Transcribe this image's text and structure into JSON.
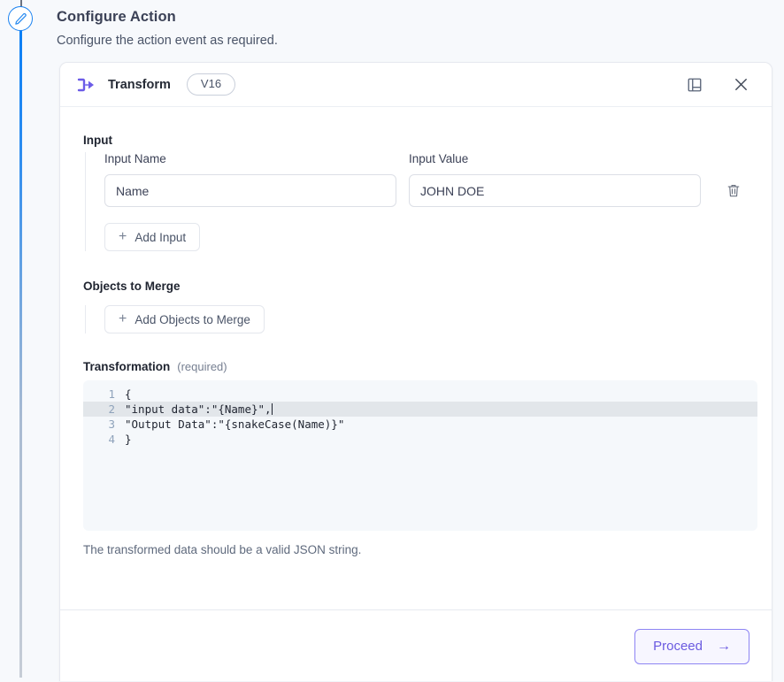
{
  "page": {
    "title": "Configure Action",
    "subtitle": "Configure the action event as required."
  },
  "rail": {
    "node_icon": "pencil-icon"
  },
  "card": {
    "icon": "transform-icon",
    "title": "Transform",
    "version_badge": "V16",
    "notes_icon": "notebook-icon",
    "close_icon": "close-icon"
  },
  "input_section": {
    "heading": "Input",
    "name_label": "Input Name",
    "name_value": "Name",
    "name_placeholder": "Name",
    "value_label": "Input Value",
    "value_value": "JOHN DOE",
    "value_placeholder": "Input Value",
    "delete_icon": "trash-icon",
    "add_button": "Add Input",
    "add_icon": "plus-icon"
  },
  "merge_section": {
    "heading": "Objects to Merge",
    "add_button": "Add Objects to Merge",
    "add_icon": "plus-icon"
  },
  "transformation_section": {
    "heading": "Transformation",
    "required_note": "(required)",
    "helper_text": "The transformed data should be a valid JSON string.",
    "code_lines": [
      {
        "number": "1",
        "text": "{",
        "active": false
      },
      {
        "number": "2",
        "text": "\"input data\":\"{Name}\",",
        "active": true
      },
      {
        "number": "3",
        "text": "\"Output Data\":\"{snakeCase(Name)}\"",
        "active": false
      },
      {
        "number": "4",
        "text": "}",
        "active": false
      }
    ]
  },
  "footer": {
    "proceed_label": "Proceed",
    "proceed_icon": "arrow-right-icon",
    "proceed_arrow": "→"
  },
  "colors": {
    "accent_purple": "#6a5ae0",
    "rail_blue": "#1a82f0",
    "node_icon_purple": "#6c5ce7",
    "page_bg": "#f7f9fc",
    "editor_bg": "#f5f8fb",
    "active_line": "#e2e6ea"
  }
}
